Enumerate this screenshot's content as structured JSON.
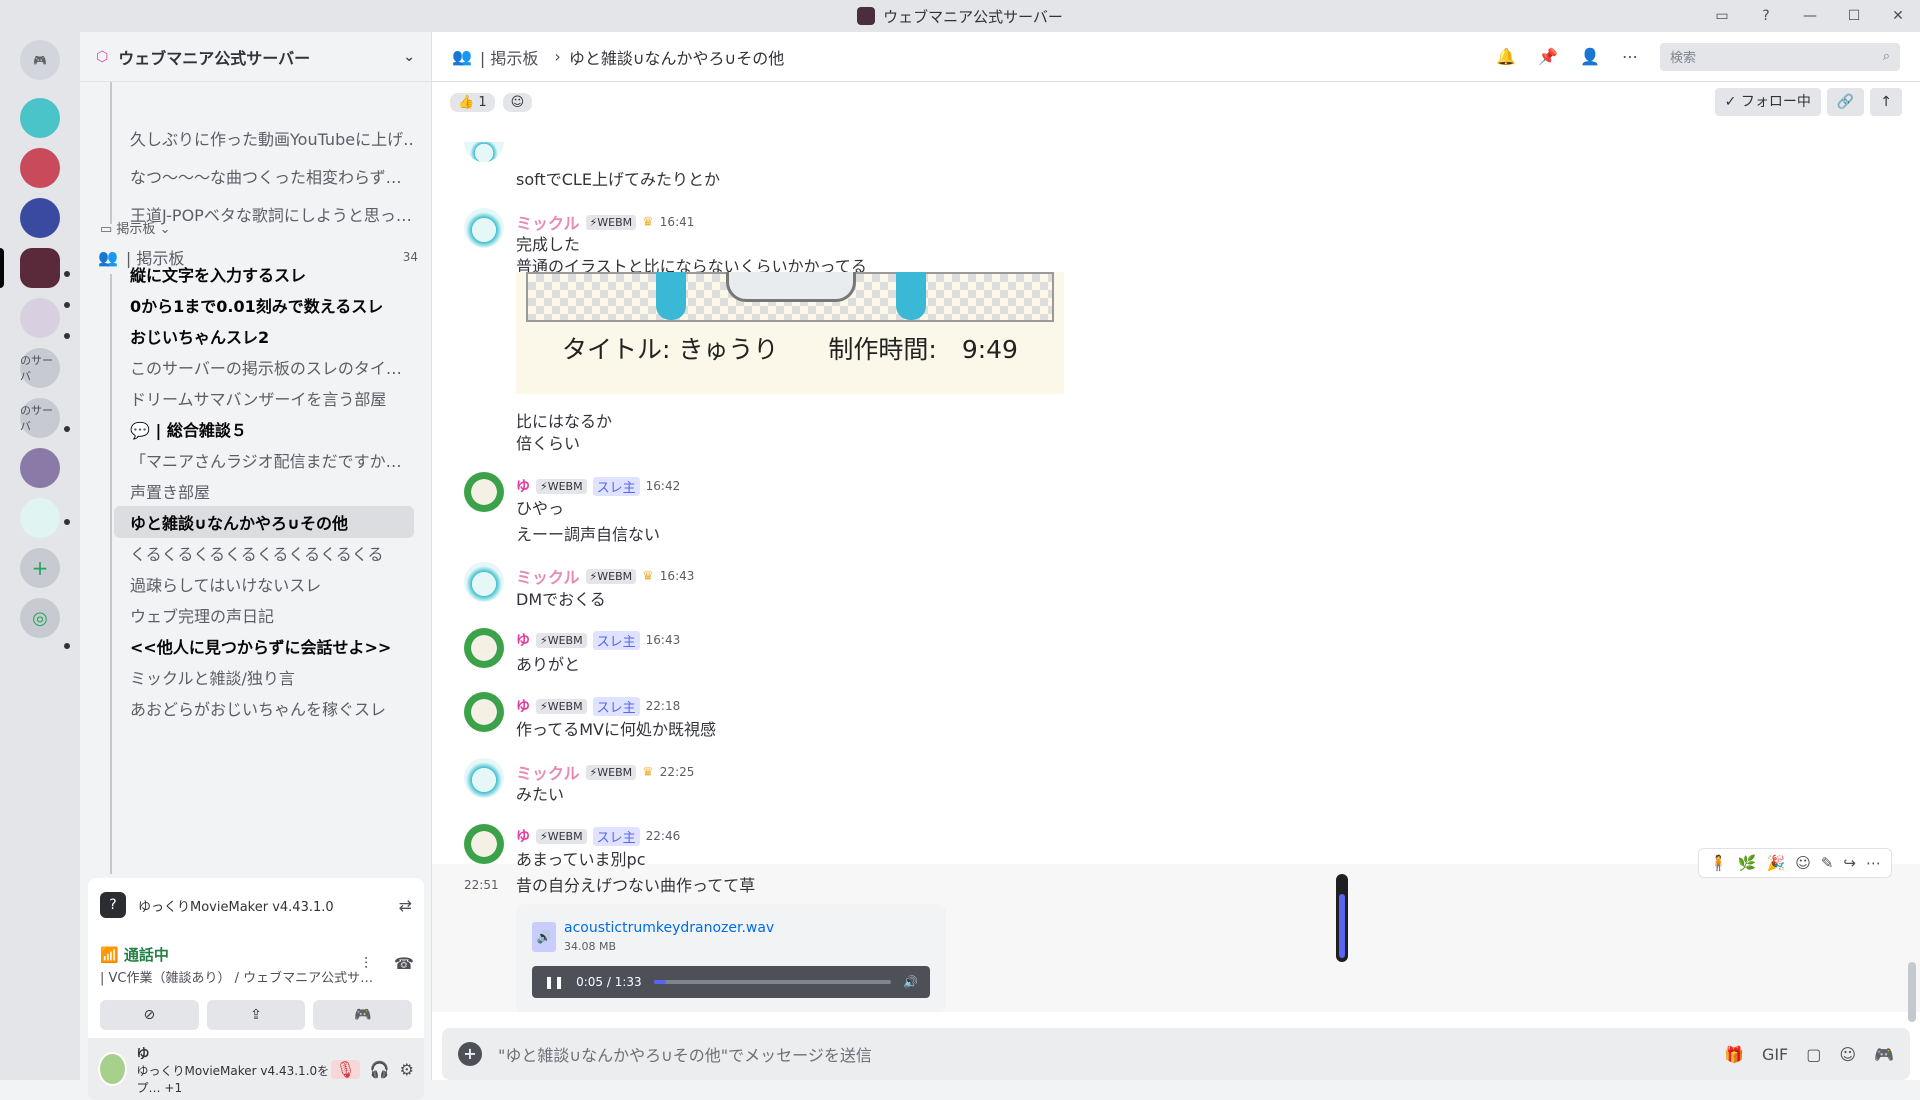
{
  "window": {
    "title": "ウェブマニア公式サーバー"
  },
  "titlebar_icons": [
    "inbox-icon",
    "help-icon",
    "minimize-icon",
    "maximize-icon",
    "close-icon"
  ],
  "rail": {
    "labels": [
      "のサーバ",
      "のサーバ"
    ]
  },
  "server": {
    "name": "ウェブマニア公式サーバー"
  },
  "threads_top": [
    "久しぶりに作った動画YouTubeに上げ…",
    "なつ〜〜〜な曲つくった相変わらず…",
    "王道J-POPベタな歌詞にしようと思っ…"
  ],
  "category": "掲示板",
  "forum": {
    "name": "| 掲示板",
    "count": "34"
  },
  "threads": [
    {
      "label": "縦に文字を入力するスレ",
      "bold": true
    },
    {
      "label": "0から1まで0.01刻みで数えるスレ",
      "bold": true
    },
    {
      "label": "おじいちゃんスレ2",
      "bold": true
    },
    {
      "label": "このサーバーの掲示板のスレのタイ…",
      "bold": false
    },
    {
      "label": "ドリームサマバンザーイを言う部屋",
      "bold": false
    },
    {
      "label": "💬 | 総合雑談５",
      "bold": true
    },
    {
      "label": "「マニアさんラジオ配信まだですか…",
      "bold": false
    },
    {
      "label": "声置き部屋",
      "bold": false
    },
    {
      "label": "ゆと雑談∪なんかやろ∪その他",
      "bold": true,
      "selected": true
    },
    {
      "label": "くるくるくるくるくるくるくるくる",
      "bold": false
    },
    {
      "label": "過疎らしてはいけないスレ",
      "bold": false
    },
    {
      "label": "ウェブ完理の声日記",
      "bold": false
    },
    {
      "label": "<<他人に見つからずに会話せよ>>",
      "bold": true
    },
    {
      "label": "ミックルと雑談/独り言",
      "bold": false
    },
    {
      "label": "あおどらがおじいちゃんを稼ぐスレ",
      "bold": false
    }
  ],
  "activity": {
    "text": "ゆっくりMovieMaker v4.43.1.0"
  },
  "voice": {
    "status": "通話中",
    "channel": "| VC作業（雑談あり） / ウェブマニア公式サ…"
  },
  "user": {
    "name": "ゆ",
    "status": "ゆっくりMovieMaker v4.43.1.0をプ…",
    "extra": "+1"
  },
  "topbar": {
    "forum": "| 掲示板",
    "thread": "ゆと雑談∪なんかやろ∪その他",
    "search_placeholder": "検索"
  },
  "subbar": {
    "reaction_count": "1",
    "follow": "✓ フォロー中"
  },
  "messages": {
    "m0_line": "softでCLE上げてみたりとか",
    "m1": {
      "name": "ミックル",
      "tag": "WEBM",
      "time": "16:41",
      "lines": [
        "完成した",
        "普通のイラストと比にならないくらいかかってる"
      ]
    },
    "image_caption": "タイトル: きゅうり　　制作時間:　9:49",
    "m1b_lines": [
      "比にはなるか",
      "倍くらい"
    ],
    "m2": {
      "name": "ゆ",
      "tag": "WEBM",
      "badge": "スレ主",
      "time": "16:42",
      "lines": [
        "ひやっ",
        "えーー調声自信ない"
      ]
    },
    "m3": {
      "name": "ミックル",
      "tag": "WEBM",
      "time": "16:43",
      "lines": [
        "DMでおくる"
      ]
    },
    "m4": {
      "name": "ゆ",
      "tag": "WEBM",
      "badge": "スレ主",
      "time": "16:43",
      "lines": [
        "ありがと"
      ]
    },
    "m5": {
      "name": "ゆ",
      "tag": "WEBM",
      "badge": "スレ主",
      "time": "22:18",
      "lines": [
        "作ってるMVに何処か既視感"
      ]
    },
    "m6": {
      "name": "ミックル",
      "tag": "WEBM",
      "time": "22:25",
      "lines": [
        "みたい"
      ]
    },
    "m7": {
      "name": "ゆ",
      "tag": "WEBM",
      "badge": "スレ主",
      "time": "22:46",
      "lines": [
        "あまっていま別pc"
      ]
    },
    "m8": {
      "time": "22:51",
      "lines": [
        "昔の自分えげつない曲作ってて草"
      ]
    }
  },
  "attachment": {
    "filename": "acoustictrumkeydranozer.wav",
    "size": "34.08 MB",
    "time": "0:05 / 1:33",
    "progress": 0.05,
    "volume": 0.8
  },
  "composer": {
    "placeholder": "\"ゆと雑談∪なんかやろ∪その他\"でメッセージを送信"
  }
}
